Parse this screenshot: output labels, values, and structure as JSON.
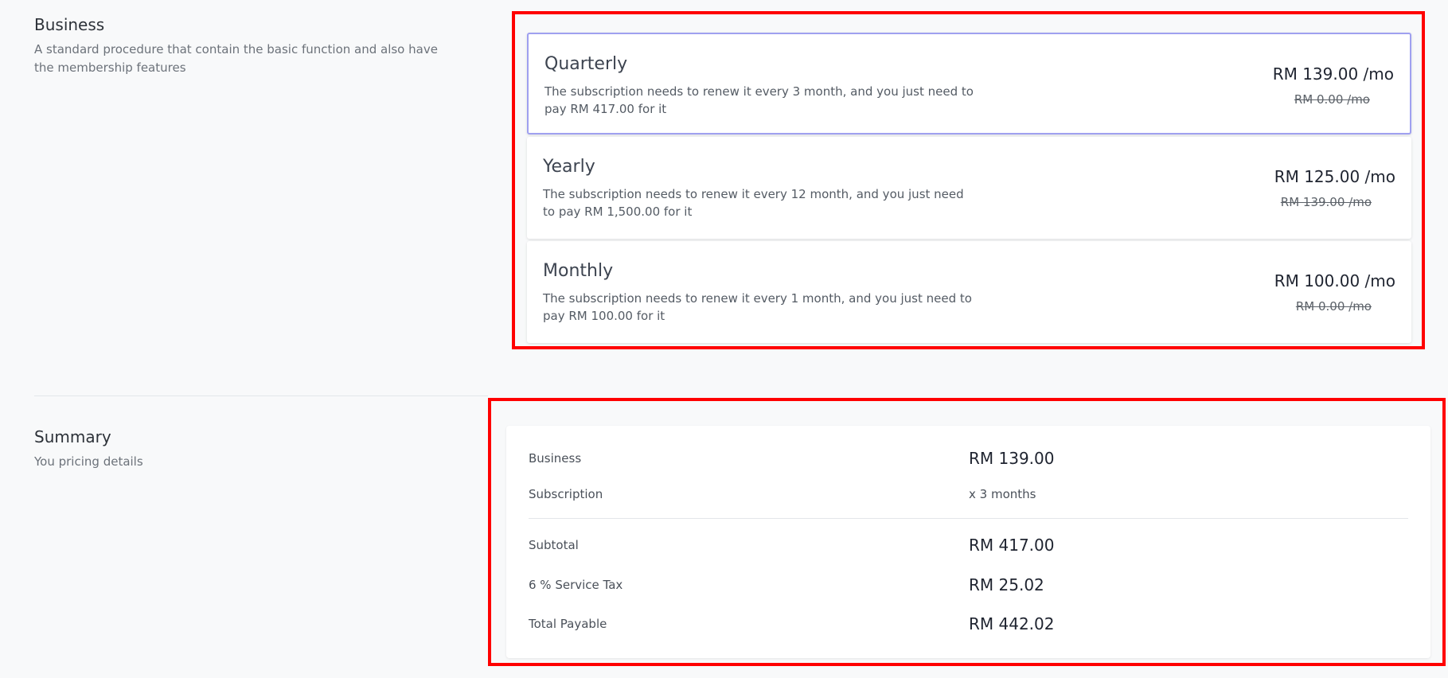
{
  "business": {
    "title": "Business",
    "description": "A standard procedure that contain the basic function and also have the membership features"
  },
  "plans": [
    {
      "name": "Quarterly",
      "description": "The subscription needs to renew it every 3 month, and you just need to pay RM 417.00 for it",
      "price": "RM 139.00 /mo",
      "old_price": "RM 0.00 /mo",
      "selected": true
    },
    {
      "name": "Yearly",
      "description": "The subscription needs to renew it every 12 month, and you just need to pay RM 1,500.00 for it",
      "price": "RM 125.00 /mo",
      "old_price": "RM 139.00 /mo",
      "selected": false
    },
    {
      "name": "Monthly",
      "description": "The subscription needs to renew it every 1 month, and you just need to pay RM 100.00 for it",
      "price": "RM 100.00 /mo",
      "old_price": "RM 0.00 /mo",
      "selected": false
    }
  ],
  "summary": {
    "title": "Summary",
    "description": "You pricing details",
    "rows": [
      {
        "label": "Business",
        "value": "RM 139.00"
      },
      {
        "label": "Subscription",
        "value": "x 3 months"
      },
      {
        "label": "Subtotal",
        "value": "RM 417.00"
      },
      {
        "label": "6 % Service Tax",
        "value": "RM 25.02"
      },
      {
        "label": "Total Payable",
        "value": "RM 442.02"
      }
    ]
  },
  "colors": {
    "highlight": "#ff0000",
    "selected_border": "#9fa0f0",
    "background": "#f8f9fa"
  }
}
